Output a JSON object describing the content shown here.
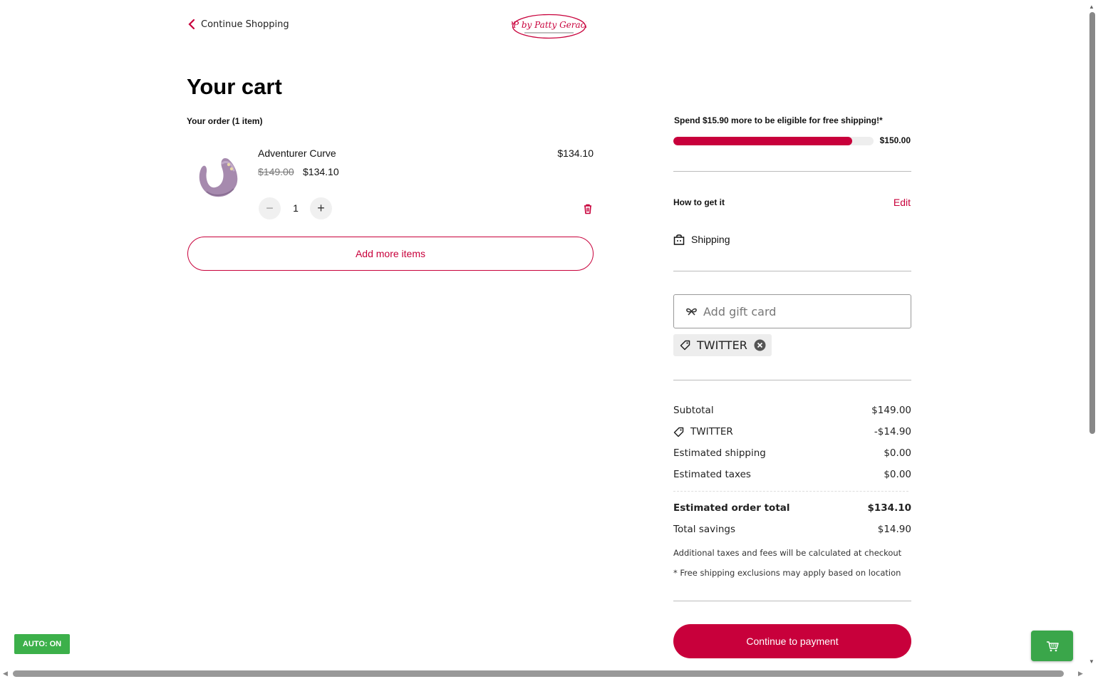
{
  "header": {
    "continue_shopping": "Continue Shopping",
    "logo_text": "PP by Patty Gerach"
  },
  "cart": {
    "title": "Your cart",
    "order_count": "Your order (1 item)",
    "item": {
      "name": "Adventurer Curve",
      "original_price": "$149.00",
      "sale_price": "$134.10",
      "line_total": "$134.10",
      "quantity": "1",
      "minus_symbol": "−",
      "plus_symbol": "+"
    },
    "add_more_label": "Add more items"
  },
  "shipping_progress": {
    "message": "Spend $15.90 more to be eligible for free shipping!*",
    "threshold_label": "$150.00",
    "progress_percent": 89.4
  },
  "delivery": {
    "label": "How to get it",
    "edit_label": "Edit",
    "option": "Shipping"
  },
  "gift_card": {
    "placeholder": "Add gift card"
  },
  "coupon": {
    "code": "TWITTER"
  },
  "summary": {
    "subtotal_label": "Subtotal",
    "subtotal_value": "$149.00",
    "discount_label": "TWITTER",
    "discount_value": "-$14.90",
    "shipping_label": "Estimated shipping",
    "shipping_value": "$0.00",
    "taxes_label": "Estimated taxes",
    "taxes_value": "$0.00",
    "total_label": "Estimated order total",
    "total_value": "$134.10",
    "savings_label": "Total savings",
    "savings_value": "$14.90",
    "note_taxes": "Additional taxes and fees will be calculated at checkout",
    "note_shipping": "* Free shipping exclusions may apply based on location"
  },
  "checkout": {
    "pay_label": "Continue to payment"
  },
  "overlay": {
    "auto_badge": "AUTO: ON"
  },
  "colors": {
    "accent": "#c8003b",
    "badge_green": "#3cb04a",
    "progress_track": "#eeeeee"
  },
  "icons": {
    "back": "chevron-left-icon",
    "delete": "trash-icon",
    "shipping": "shopping-bag-icon",
    "gift": "gift-ribbon-icon",
    "coupon": "tag-icon",
    "remove": "close-circle-icon",
    "cart": "cart-icon"
  }
}
